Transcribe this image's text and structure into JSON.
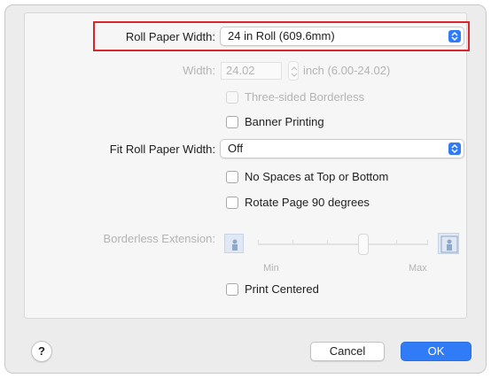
{
  "roll_paper_width": {
    "label": "Roll Paper Width:",
    "value": "24 in Roll (609.6mm)"
  },
  "width": {
    "label": "Width:",
    "value": "24.02",
    "unit": "inch (6.00-24.02)"
  },
  "checkboxes": {
    "three_sided_borderless": {
      "label": "Three-sided Borderless",
      "checked": false,
      "enabled": false
    },
    "banner_printing": {
      "label": "Banner Printing",
      "checked": false,
      "enabled": true
    },
    "no_spaces": {
      "label": "No Spaces at Top or Bottom",
      "checked": false,
      "enabled": true
    },
    "rotate_page": {
      "label": "Rotate Page 90 degrees",
      "checked": false,
      "enabled": true
    },
    "print_centered": {
      "label": "Print Centered",
      "checked": false,
      "enabled": true
    }
  },
  "fit_roll_paper_width": {
    "label": "Fit Roll Paper Width:",
    "value": "Off"
  },
  "borderless_extension": {
    "label": "Borderless Extension:",
    "min_label": "Min",
    "max_label": "Max",
    "level": 0.62
  },
  "footer": {
    "help": "?",
    "cancel": "Cancel",
    "ok": "OK"
  },
  "colors": {
    "accent": "#2f7cf6",
    "highlight": "#d9262c"
  }
}
